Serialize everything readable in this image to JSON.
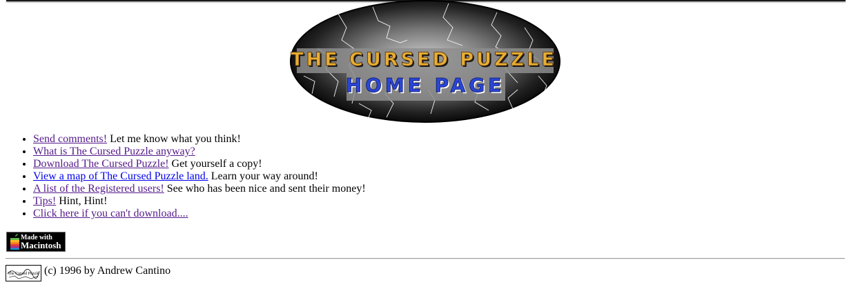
{
  "banner": {
    "title_line1": "THE CURSED PUZZLE",
    "title_line2": "HOME PAGE",
    "colors": {
      "title": "#e7ad34",
      "subtitle": "#2b46d6",
      "backdrop": "#000000"
    }
  },
  "links": [
    {
      "label": "Send comments!",
      "description": "Let me know what you think!",
      "visited": true
    },
    {
      "label": "What is The Cursed Puzzle anyway?",
      "description": "",
      "visited": true
    },
    {
      "label": "Download The Cursed Puzzle!",
      "description": "Get yourself a copy!",
      "visited": true
    },
    {
      "label": "View a map of The Cursed Puzzle land.",
      "description": "Learn your way around!",
      "visited": false
    },
    {
      "label": "A list of the Registered users!",
      "description": "See who has been nice and sent their money!",
      "visited": true
    },
    {
      "label": "Tips!",
      "description": "Hint, Hint!",
      "visited": true
    },
    {
      "label": "Click here if you can't download....",
      "description": "",
      "visited": true
    }
  ],
  "badge": {
    "line1": "Made with",
    "line2": "Macintosh"
  },
  "footer": {
    "mini_logo_text": "The Cursed Puzzle",
    "copyright": "(c) 1996 by Andrew Cantino"
  },
  "colors": {
    "link_visited": "#551a8b",
    "link_unvisited": "#0000ee"
  }
}
